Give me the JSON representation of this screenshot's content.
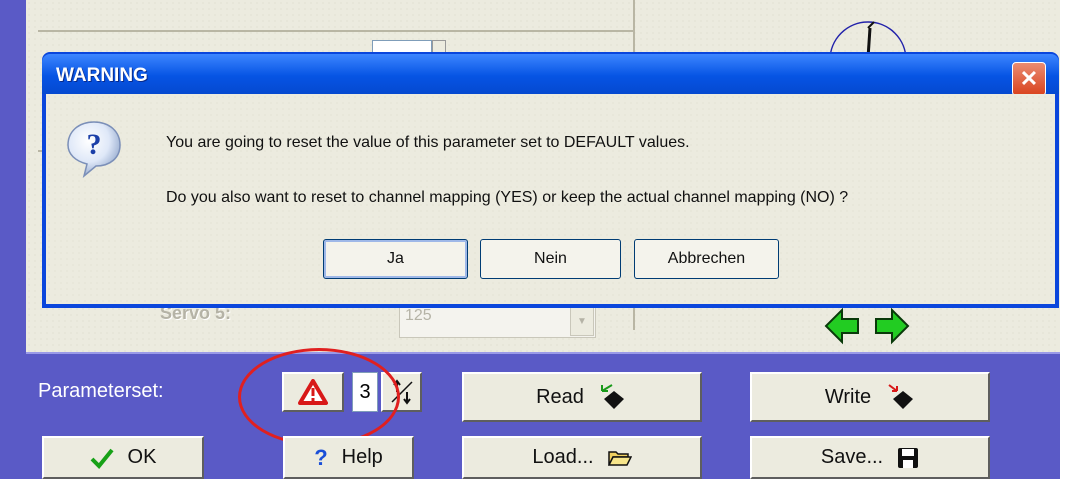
{
  "dialog": {
    "title": "WARNING",
    "close_glyph": "✕",
    "icon": "question-icon",
    "message_line1": "You are going to reset the value of this parameter set to DEFAULT values.",
    "message_line2": "Do you also want to reset to channel mapping (YES) or keep the actual channel mapping (NO) ?",
    "buttons": {
      "yes": "Ja",
      "no": "Nein",
      "cancel": "Abbrechen"
    }
  },
  "background": {
    "servo_label": "Servo 5:",
    "servo_value": "125",
    "dropdown_glyph": "▼"
  },
  "bottom_bar": {
    "parameterset_label": "Parameterset:",
    "parameterset_value": "3",
    "read_label": "Read",
    "write_label": "Write",
    "ok_label": "OK",
    "help_label": "Help",
    "load_label": "Load...",
    "save_label": "Save..."
  },
  "colors": {
    "titlebar": "#0654e4",
    "bar": "#5a5ac6",
    "highlight_oval": "#e02020",
    "arrow_green": "#22cc22"
  }
}
